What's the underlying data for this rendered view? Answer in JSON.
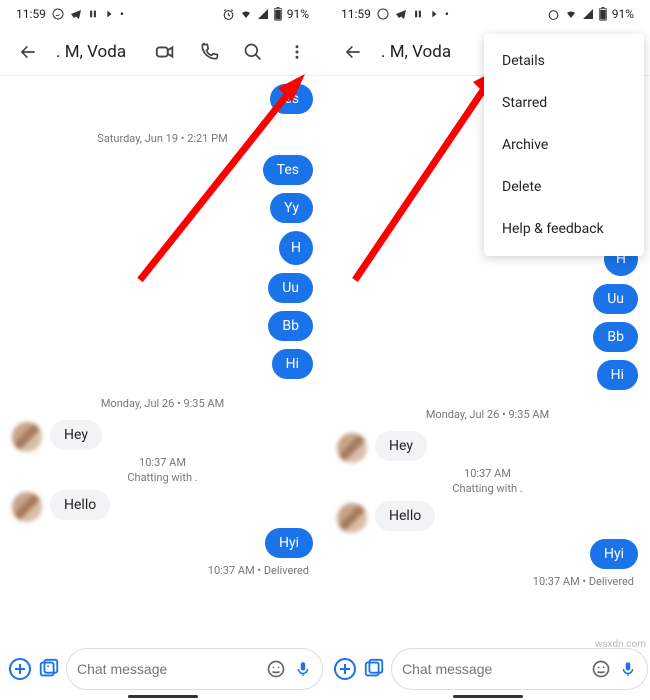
{
  "status": {
    "time": "11:59",
    "battery": "91%"
  },
  "header": {
    "title": ". M, Voda"
  },
  "timeline": {
    "date1": "Saturday, Jun 19 • 2:21 PM",
    "date2": "Monday, Jul 26 • 9:35 AM",
    "time1": "10:37 AM",
    "chatting": "Chatting with .",
    "delivered": "10:37 AM • Delivered"
  },
  "messages": {
    "tes": "Tes",
    "yy": "Yy",
    "h": "H",
    "uu": "Uu",
    "bb": "Bb",
    "hi": "Hi",
    "hey": "Hey",
    "hello": "Hello",
    "hyi": "Hyi",
    "es": "es"
  },
  "composer": {
    "placeholder": "Chat message"
  },
  "menu": {
    "details": "Details",
    "starred": "Starred",
    "archive": "Archive",
    "delete": "Delete",
    "help": "Help & feedback"
  },
  "watermark": "wsxdn.com"
}
